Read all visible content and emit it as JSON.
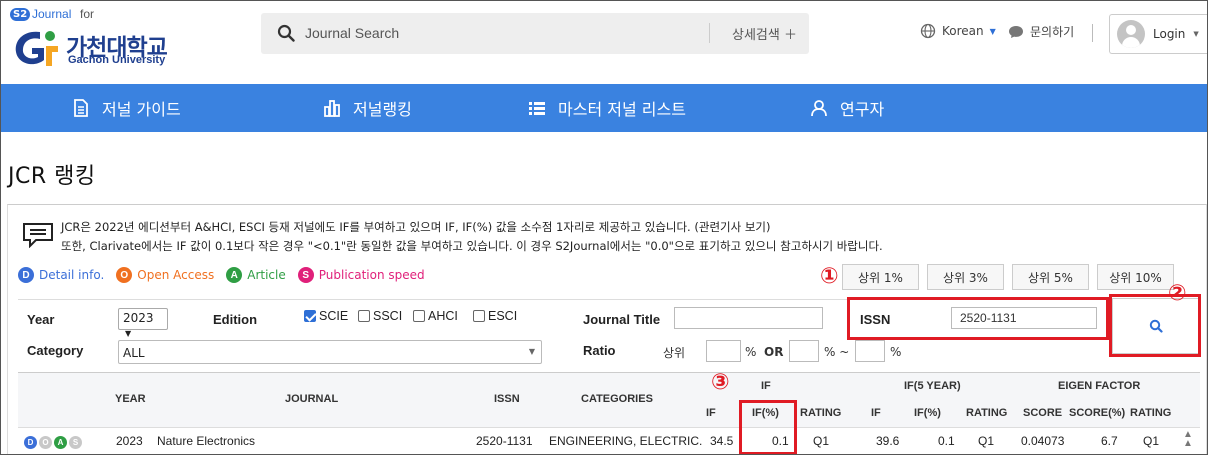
{
  "header": {
    "logo": {
      "badge": "S2",
      "journal": "Journal",
      "for": "for",
      "name_ko": "가천대학교",
      "name_en": "Gachon University"
    },
    "search": {
      "placeholder": "Journal Search",
      "advanced_label": "상세검색 ＋"
    },
    "language": "Korean",
    "contact": "문의하기",
    "login": "Login"
  },
  "nav": {
    "items": [
      {
        "label": "저널 가이드",
        "icon": "document-icon"
      },
      {
        "label": "저널랭킹",
        "icon": "bar-chart-icon"
      },
      {
        "label": "마스터 저널 리스트",
        "icon": "list-icon"
      },
      {
        "label": "연구자",
        "icon": "user-icon"
      }
    ]
  },
  "page_title": "JCR 랭킹",
  "notice": {
    "line1": "JCR은 2022년 에디션부터 A&HCI, ESCI 등재 저널에도 IF를 부여하고 있으며 IF, IF(%) 값을 소수점 1자리로 제공하고 있습니다. (관련기사 보기)",
    "line2": "또한, Clarivate에서는 IF 값이 0.1보다 작은 경우 \"<0.1\"란 동일한 값을 부여하고 있습니다. 이 경우 S2Journal에서는 \"0.0\"으로 표기하고 있으니 참고하시기 바랍니다."
  },
  "legend": [
    {
      "letter": "D",
      "label": "Detail info.",
      "color": "#3b6fd8",
      "text_color": "#3b6fd8"
    },
    {
      "letter": "O",
      "label": "Open Access",
      "color": "#f07020",
      "text_color": "#f07020"
    },
    {
      "letter": "A",
      "label": "Article",
      "color": "#2f9e44",
      "text_color": "#2f9e44"
    },
    {
      "letter": "S",
      "label": "Publication speed",
      "color": "#e0207a",
      "text_color": "#e0207a"
    }
  ],
  "percent_buttons": [
    "상위 1%",
    "상위 3%",
    "상위 5%",
    "상위 10%"
  ],
  "filter": {
    "year_label": "Year",
    "year_value": "2023",
    "edition_label": "Edition",
    "editions": [
      {
        "label": "SCIE",
        "checked": true
      },
      {
        "label": "SSCI",
        "checked": false
      },
      {
        "label": "AHCI",
        "checked": false
      },
      {
        "label": "ESCI",
        "checked": false
      }
    ],
    "journal_title_label": "Journal Title",
    "journal_title_value": "",
    "issn_label": "ISSN",
    "issn_value": "2520-1131",
    "category_label": "Category",
    "category_value": "ALL",
    "ratio_label": "Ratio",
    "ratio_prefix": "상위",
    "pct": "%",
    "or": "OR",
    "pct_tilde": "% ~",
    "pct_end": "%"
  },
  "annotations": [
    "①",
    "②",
    "③"
  ],
  "table": {
    "headers": {
      "year": "YEAR",
      "journal": "JOURNAL",
      "issn": "ISSN",
      "categories": "CATEGORIES",
      "if_group": "IF",
      "if": "IF",
      "if_pct": "IF(%)",
      "rating": "RATING",
      "if5_group": "IF(5 YEAR)",
      "if5": "IF",
      "if5_pct": "IF(%)",
      "if5_rating": "RATING",
      "eigen_group": "EIGEN FACTOR",
      "score": "SCORE",
      "score_pct": "SCORE(%)",
      "eigen_rating": "RATING"
    },
    "rows": [
      {
        "icons": [
          "D",
          "O",
          "A",
          "S"
        ],
        "year": "2023",
        "journal": "Nature Electronics",
        "issn": "2520-1131",
        "categories": "ENGINEERING, ELECTRIC.",
        "if": "34.5",
        "if_pct": "0.1",
        "rating": "Q1",
        "if5": "39.6",
        "if5_pct": "0.1",
        "if5_rating": "Q1",
        "score": "0.04073",
        "score_pct": "6.7",
        "eigen_rating": "Q1"
      }
    ]
  }
}
